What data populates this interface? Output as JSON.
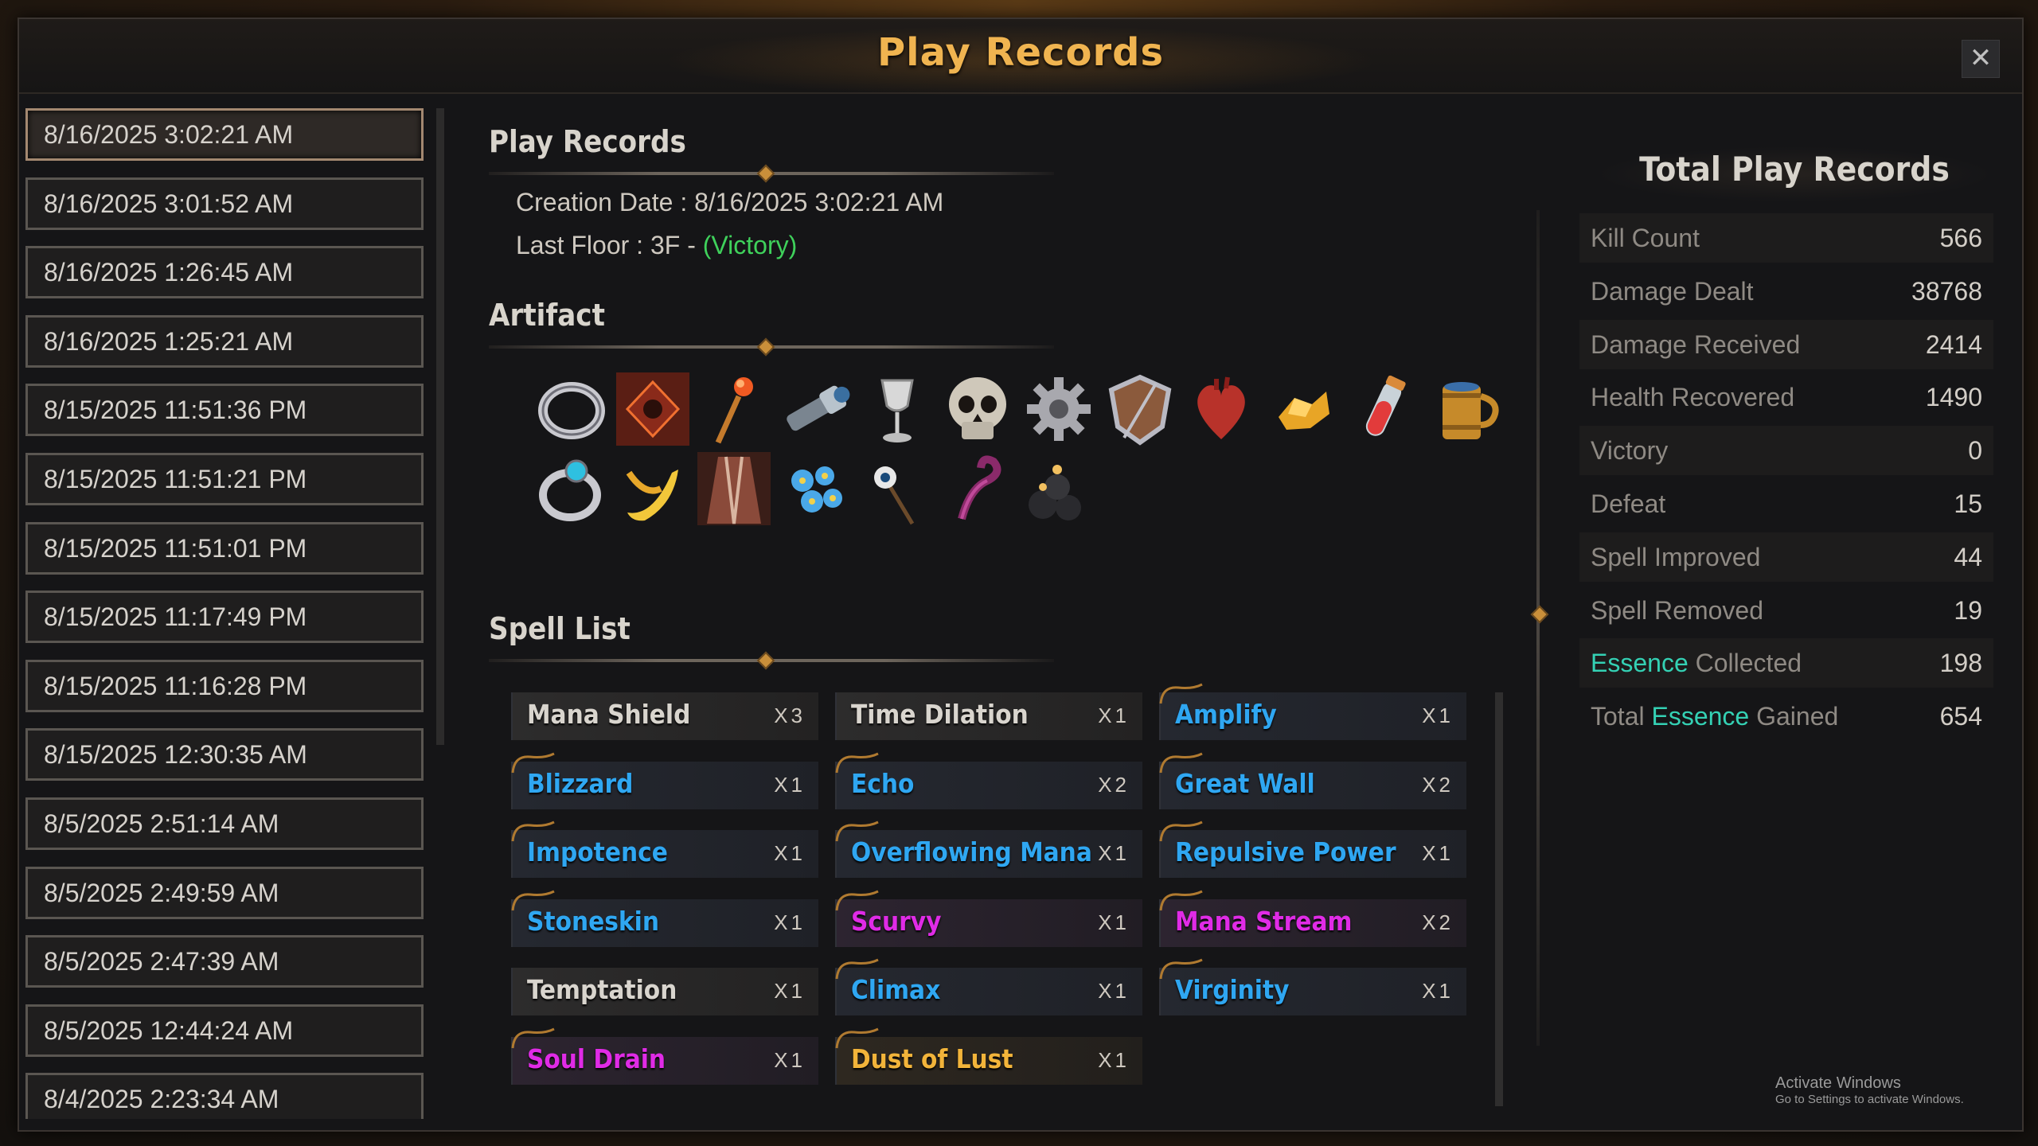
{
  "window": {
    "title": "Play Records",
    "close_label": "✕"
  },
  "records": [
    "8/16/2025 3:02:21 AM",
    "8/16/2025 3:01:52 AM",
    "8/16/2025 1:26:45 AM",
    "8/16/2025 1:25:21 AM",
    "8/15/2025 11:51:36 PM",
    "8/15/2025 11:51:21 PM",
    "8/15/2025 11:51:01 PM",
    "8/15/2025 11:17:49 PM",
    "8/15/2025 11:16:28 PM",
    "8/15/2025 12:30:35 AM",
    "8/5/2025 2:51:14 AM",
    "8/5/2025 2:49:59 AM",
    "8/5/2025 2:47:39 AM",
    "8/5/2025 12:44:24 AM",
    "8/4/2025 2:23:34 AM"
  ],
  "details": {
    "title": "Play Records",
    "creation_label": "Creation Date : ",
    "creation_value": "8/16/2025 3:02:21 AM",
    "floor_label": "Last Floor : 3F - ",
    "floor_result": "(Victory)",
    "artifact_title": "Artifact",
    "spell_title": "Spell List",
    "artifacts": [
      "silver-ring-icon",
      "demon-emblem-icon",
      "flame-staff-icon",
      "spyglass-icon",
      "wine-glass-icon",
      "skull-icon",
      "gear-icon",
      "wooden-shield-icon",
      "heart-icon",
      "gold-nugget-icon",
      "red-potion-icon",
      "beer-mug-icon",
      "sapphire-ring-icon",
      "banana-icon",
      "tattered-robe-icon",
      "blue-flowers-icon",
      "eye-staff-icon",
      "purple-tentacle-icon",
      "black-bombs-icon"
    ]
  },
  "spells": [
    {
      "name": "Mana Shield",
      "count": "X3",
      "color": "white"
    },
    {
      "name": "Time Dilation",
      "count": "X1",
      "color": "white"
    },
    {
      "name": "Amplify",
      "count": "X1",
      "color": "blue"
    },
    {
      "name": "Blizzard",
      "count": "X1",
      "color": "blue"
    },
    {
      "name": "Echo",
      "count": "X2",
      "color": "blue"
    },
    {
      "name": "Great Wall",
      "count": "X2",
      "color": "blue"
    },
    {
      "name": "Impotence",
      "count": "X1",
      "color": "blue"
    },
    {
      "name": "Overflowing Mana",
      "count": "X1",
      "color": "blue"
    },
    {
      "name": "Repulsive Power",
      "count": "X1",
      "color": "blue"
    },
    {
      "name": "Stoneskin",
      "count": "X1",
      "color": "blue"
    },
    {
      "name": "Scurvy",
      "count": "X1",
      "color": "purple"
    },
    {
      "name": "Mana Stream",
      "count": "X2",
      "color": "purple"
    },
    {
      "name": "Temptation",
      "count": "X1",
      "color": "white"
    },
    {
      "name": "Climax",
      "count": "X1",
      "color": "blue"
    },
    {
      "name": "Virginity",
      "count": "X1",
      "color": "blue"
    },
    {
      "name": "Soul Drain",
      "count": "X1",
      "color": "purple"
    },
    {
      "name": "Dust of Lust",
      "count": "X1",
      "color": "gold"
    }
  ],
  "totals": {
    "title": "Total Play Records",
    "essence_word": "Essence",
    "stats": [
      {
        "label": "Kill Count",
        "value": "566"
      },
      {
        "label": "Damage Dealt",
        "value": "38768"
      },
      {
        "label": "Damage Received",
        "value": "2414"
      },
      {
        "label": "Health Recovered",
        "value": "1490"
      },
      {
        "label": "Victory",
        "value": "0"
      },
      {
        "label": "Defeat",
        "value": "15"
      },
      {
        "label": "Spell Improved",
        "value": "44"
      },
      {
        "label": "Spell Removed",
        "value": "19"
      },
      {
        "label": "Collected",
        "value": "198",
        "prefix_essence": true,
        "prefix": ""
      },
      {
        "label": "Gained",
        "value": "654",
        "prefix_essence": true,
        "prefix": "Total "
      }
    ]
  },
  "watermark": {
    "line1": "Activate Windows",
    "line2": "Go to Settings to activate Windows."
  },
  "colors": {
    "title_gold": "#f0b450",
    "victory_green": "#3fd15b",
    "essence_teal": "#34d1b4",
    "spell_blue": "#2fa7f2",
    "spell_purple": "#e02be6",
    "spell_gold": "#f2b43a"
  }
}
